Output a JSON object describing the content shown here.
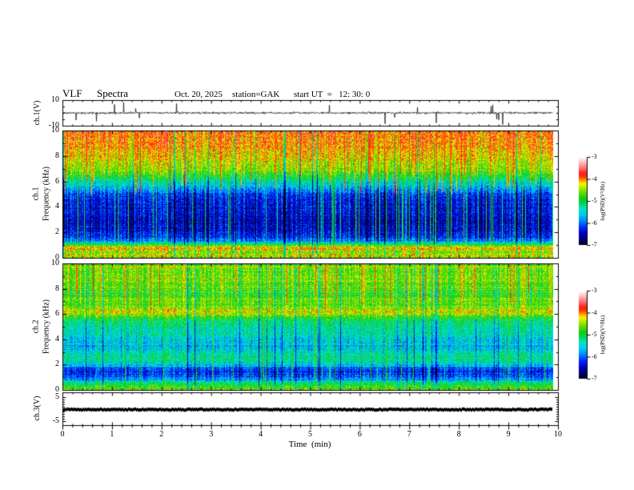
{
  "header": {
    "title": "VLF  Spectra",
    "date": "Oct. 20, 2025",
    "station": "station=GAK",
    "start_ut": "start UT  =   12: 30: 0"
  },
  "xaxis": {
    "label": "Time  (min)",
    "ticks": [
      "0",
      "1",
      "2",
      "3",
      "4",
      "5",
      "6",
      "7",
      "8",
      "9",
      "10"
    ],
    "tick_values": [
      0,
      1,
      2,
      3,
      4,
      5,
      6,
      7,
      8,
      9,
      10
    ],
    "minor_per_major": 5,
    "range_min": [
      0,
      10
    ],
    "data_end_fraction": 0.988
  },
  "colorbar": {
    "label": "log(PSD)(V²/Hz)",
    "ticks": [
      "-3",
      "-4",
      "-5",
      "-6",
      "-7"
    ],
    "tick_values": [
      -3,
      -4,
      -5,
      -6,
      -7
    ]
  },
  "colormap": {
    "stops": [
      [
        0.0,
        "#000011"
      ],
      [
        0.06,
        "#000066"
      ],
      [
        0.13,
        "#0000bb"
      ],
      [
        0.2,
        "#0022ff"
      ],
      [
        0.28,
        "#0088ff"
      ],
      [
        0.35,
        "#00ccee"
      ],
      [
        0.42,
        "#00e8bb"
      ],
      [
        0.48,
        "#00d455"
      ],
      [
        0.53,
        "#11cc11"
      ],
      [
        0.6,
        "#66dd00"
      ],
      [
        0.66,
        "#bbee00"
      ],
      [
        0.7,
        "#ffee00"
      ],
      [
        0.74,
        "#ff9900"
      ],
      [
        0.78,
        "#ff3300"
      ],
      [
        0.82,
        "#ff2222"
      ],
      [
        0.88,
        "#ff7777"
      ],
      [
        0.94,
        "#ffbbbb"
      ],
      [
        1.0,
        "#ffffff"
      ]
    ],
    "value_range": [
      -7,
      -3
    ]
  },
  "chart_data": [
    {
      "type": "line",
      "id": "ch1",
      "ylabel": "ch.1(V)",
      "ylim": [
        -10,
        10
      ],
      "ytick_labels": [
        "10",
        "-10"
      ],
      "ytick_values": [
        10,
        -10
      ],
      "yminor_values": [
        5,
        0,
        -5
      ],
      "signal": {
        "baseline": 0,
        "noise_amp": 0.8,
        "spike_prob": 0.012,
        "spike_min": 3,
        "spike_max": 9
      },
      "line_color": "#000000",
      "seed": 11
    },
    {
      "type": "heatmap",
      "id": "sp1",
      "ylabel": "ch.1\nFrequency  (kHz)",
      "ylim": [
        0,
        10
      ],
      "ytick_labels": [
        "10",
        "8",
        "6",
        "4",
        "2",
        "0"
      ],
      "ytick_values": [
        10,
        8,
        6,
        4,
        2,
        0
      ],
      "yminor_values": [
        1,
        3,
        5,
        7,
        9
      ],
      "profile": [
        [
          0,
          -4.2
        ],
        [
          0.15,
          -4.45
        ],
        [
          0.3,
          -4.25
        ],
        [
          0.6,
          -4.55
        ],
        [
          0.75,
          -4.1
        ],
        [
          0.95,
          -4.3
        ],
        [
          1.1,
          -4.8
        ],
        [
          1.4,
          -5.9
        ],
        [
          2,
          -6.3
        ],
        [
          3,
          -6.45
        ],
        [
          4,
          -6.35
        ],
        [
          5,
          -6.15
        ],
        [
          5.5,
          -5.8
        ],
        [
          6,
          -5.3
        ],
        [
          6.5,
          -4.85
        ],
        [
          7,
          -4.55
        ],
        [
          8,
          -4.25
        ],
        [
          9,
          -4.0
        ],
        [
          10,
          -3.92
        ]
      ],
      "col_var": 0.55,
      "row_band": 0.12,
      "noise": 0.38,
      "streak_bright_prob": 0.05,
      "streak_dark_prob": 0.05,
      "flame_prob": 0.1,
      "flame_base": 5.0,
      "seed": 23
    },
    {
      "type": "heatmap",
      "id": "sp2",
      "ylabel": "ch.2\nFrequency  (kHz)",
      "ylim": [
        0,
        10
      ],
      "ytick_labels": [
        "10",
        "8",
        "6",
        "4",
        "2",
        "0"
      ],
      "ytick_values": [
        10,
        8,
        6,
        4,
        2,
        0
      ],
      "yminor_values": [
        1,
        3,
        5,
        7,
        9
      ],
      "profile": [
        [
          0,
          -4.3
        ],
        [
          0.25,
          -4.9
        ],
        [
          0.6,
          -5.1
        ],
        [
          0.9,
          -5.7
        ],
        [
          1.2,
          -6.15
        ],
        [
          1.8,
          -6.1
        ],
        [
          2.1,
          -5.5
        ],
        [
          2.5,
          -5.15
        ],
        [
          3,
          -5.5
        ],
        [
          3.6,
          -5.65
        ],
        [
          4.2,
          -5.45
        ],
        [
          4.8,
          -5.25
        ],
        [
          5.4,
          -5.15
        ],
        [
          5.9,
          -4.9
        ],
        [
          6.1,
          -4.25
        ],
        [
          6.35,
          -4.2
        ],
        [
          6.6,
          -4.65
        ],
        [
          7.2,
          -4.75
        ],
        [
          8,
          -4.7
        ],
        [
          9,
          -4.65
        ],
        [
          10,
          -4.55
        ]
      ],
      "col_var": 0.5,
      "row_band": 0.22,
      "noise": 0.35,
      "streak_bright_prob": 0.06,
      "streak_dark_prob": 0.04,
      "flame_prob": 0.06,
      "flame_base": 6.2,
      "seed": 57
    },
    {
      "type": "line",
      "id": "ch3",
      "ylabel": "ch.3(V)",
      "ylim": [
        -6.7,
        7.0
      ],
      "ytick_labels": [
        "5",
        "-5"
      ],
      "ytick_values": [
        5,
        -5
      ],
      "yminor_values": [
        4,
        3,
        2,
        1,
        0,
        -1,
        -2,
        -3,
        -4
      ],
      "signal": {
        "baseline": -0.2,
        "thickness": 4,
        "jitter": 1.6
      },
      "line_color": "#000000",
      "seed": 99
    }
  ]
}
